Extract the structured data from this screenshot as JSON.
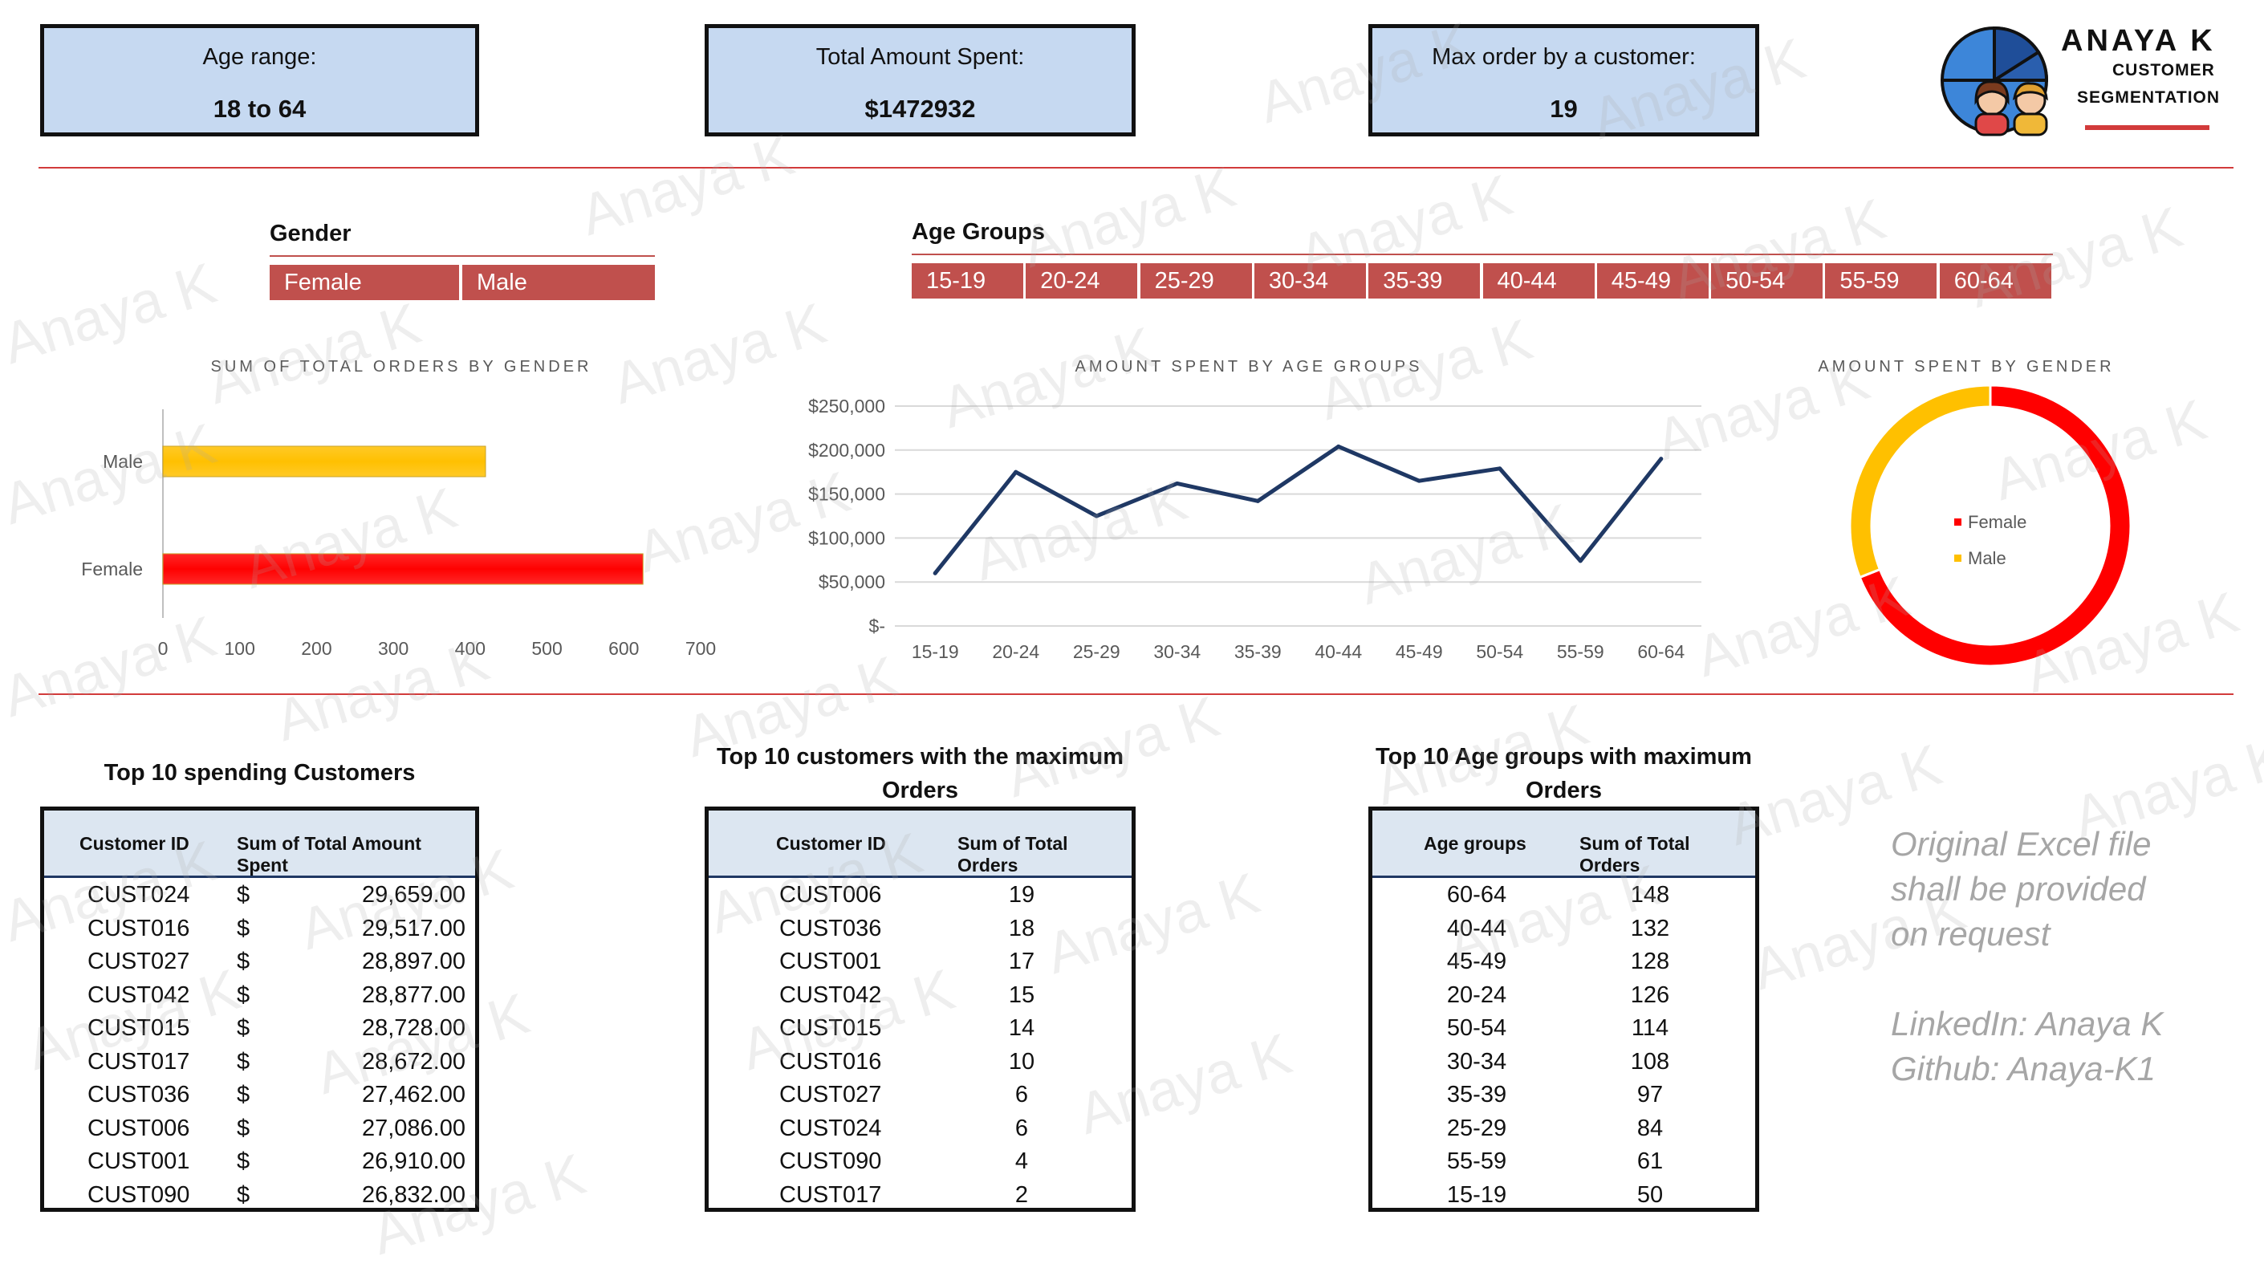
{
  "kpis": {
    "age_range_label": "Age range:",
    "age_range_value": "18 to 64",
    "total_spent_label": "Total Amount Spent:",
    "total_spent_value": "$1472932",
    "max_order_label": "Max order by a customer:",
    "max_order_value": "19"
  },
  "logo": {
    "name": "ANAYA K",
    "line1": "CUSTOMER",
    "line2": "SEGMENTATION"
  },
  "slicers": {
    "gender_title": "Gender",
    "gender_items": [
      "Female",
      "Male"
    ],
    "age_title": "Age Groups",
    "age_items": [
      "15-19",
      "20-24",
      "25-29",
      "30-34",
      "35-39",
      "40-44",
      "45-49",
      "50-54",
      "55-59",
      "60-64"
    ]
  },
  "chart_data": [
    {
      "type": "bar",
      "orientation": "horizontal",
      "title": "SUM OF TOTAL ORDERS BY GENDER",
      "categories": [
        "Male",
        "Female"
      ],
      "values": [
        420,
        625
      ],
      "colors": [
        "#ffc000",
        "#ff0000"
      ],
      "xlim": [
        0,
        700
      ],
      "xticks": [
        "0",
        "100",
        "200",
        "300",
        "400",
        "500",
        "600",
        "700"
      ]
    },
    {
      "type": "line",
      "title": "AMOUNT SPENT BY AGE GROUPS",
      "categories": [
        "15-19",
        "20-24",
        "25-29",
        "30-34",
        "35-39",
        "40-44",
        "45-49",
        "50-54",
        "55-59",
        "60-64"
      ],
      "values": [
        60000,
        175000,
        125000,
        162000,
        142000,
        204000,
        165000,
        179000,
        74000,
        190000
      ],
      "color": "#1f3864",
      "ylim": [
        0,
        250000
      ],
      "yticks": [
        "$-",
        "$50,000",
        "$100,000",
        "$150,000",
        "$200,000",
        "$250,000"
      ],
      "grid": true
    },
    {
      "type": "pie",
      "donut": true,
      "title": "AMOUNT SPENT BY GENDER",
      "categories": [
        "Female",
        "Male"
      ],
      "values": [
        69,
        31
      ],
      "colors": [
        "#ff0000",
        "#ffc000"
      ],
      "legend": "center"
    }
  ],
  "tables": {
    "spending": {
      "title": "Top 10 spending Customers",
      "headers": [
        "Customer ID",
        "Sum of Total Amount Spent"
      ],
      "rows": [
        [
          "CUST024",
          "$",
          "29,659.00"
        ],
        [
          "CUST016",
          "$",
          "29,517.00"
        ],
        [
          "CUST027",
          "$",
          "28,897.00"
        ],
        [
          "CUST042",
          "$",
          "28,877.00"
        ],
        [
          "CUST015",
          "$",
          "28,728.00"
        ],
        [
          "CUST017",
          "$",
          "28,672.00"
        ],
        [
          "CUST036",
          "$",
          "27,462.00"
        ],
        [
          "CUST006",
          "$",
          "27,086.00"
        ],
        [
          "CUST001",
          "$",
          "26,910.00"
        ],
        [
          "CUST090",
          "$",
          "26,832.00"
        ]
      ]
    },
    "orders": {
      "title": "Top 10 customers with the maximum Orders",
      "headers": [
        "Customer ID",
        "Sum of Total Orders"
      ],
      "rows": [
        [
          "CUST006",
          "19"
        ],
        [
          "CUST036",
          "18"
        ],
        [
          "CUST001",
          "17"
        ],
        [
          "CUST042",
          "15"
        ],
        [
          "CUST015",
          "14"
        ],
        [
          "CUST016",
          "10"
        ],
        [
          "CUST027",
          "6"
        ],
        [
          "CUST024",
          "6"
        ],
        [
          "CUST090",
          "4"
        ],
        [
          "CUST017",
          "2"
        ]
      ]
    },
    "age_groups": {
      "title": "Top 10 Age groups with maximum Orders",
      "headers": [
        "Age groups",
        "Sum of Total Orders"
      ],
      "rows": [
        [
          "60-64",
          "148"
        ],
        [
          "40-44",
          "132"
        ],
        [
          "45-49",
          "128"
        ],
        [
          "20-24",
          "126"
        ],
        [
          "50-54",
          "114"
        ],
        [
          "30-34",
          "108"
        ],
        [
          "35-39",
          "97"
        ],
        [
          "25-29",
          "84"
        ],
        [
          "55-59",
          "61"
        ],
        [
          "15-19",
          "50"
        ]
      ]
    }
  },
  "notes": {
    "line1": "Original Excel file",
    "line2": "shall be provided",
    "line3": "on request",
    "line4": "LinkedIn: Anaya K",
    "line5": "Github: Anaya-K1"
  },
  "watermark": "Anaya K"
}
